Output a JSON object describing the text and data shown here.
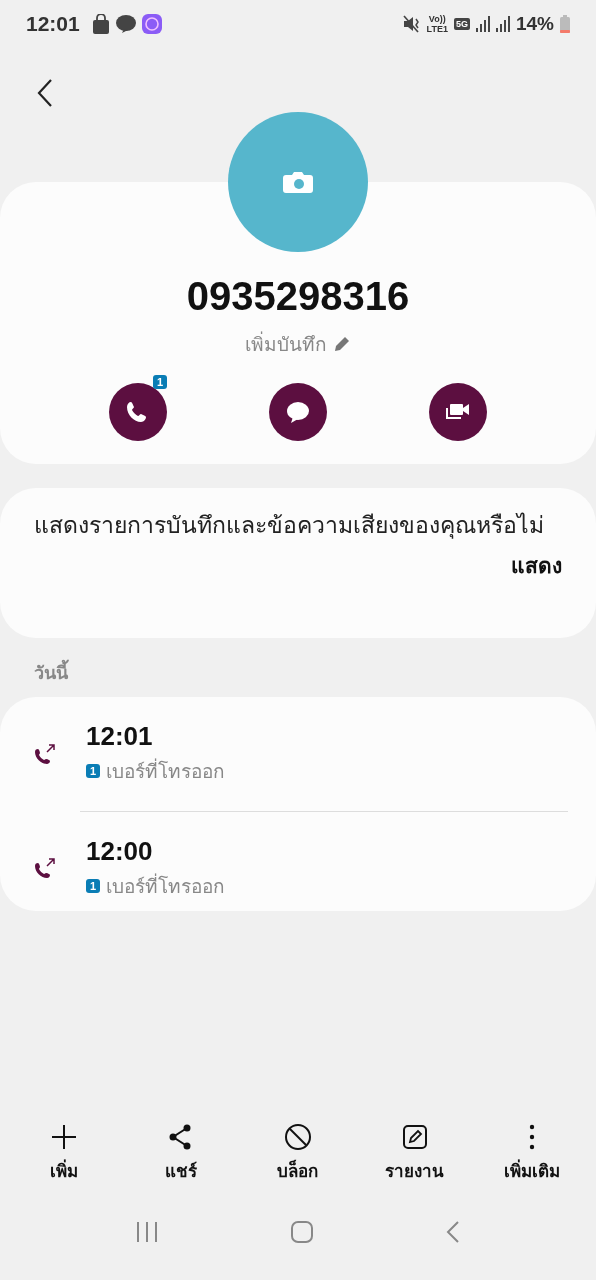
{
  "status_bar": {
    "time": "12:01",
    "volte": "Vo))",
    "lte": "LTE1",
    "network": "5G",
    "battery": "14%"
  },
  "contact": {
    "number": "0935298316",
    "note_link": "เพิ่มบันทึก"
  },
  "actions": [
    {
      "kind": "call",
      "badge": "1"
    },
    {
      "kind": "message"
    },
    {
      "kind": "video"
    }
  ],
  "prompt": {
    "text": "แสดงรายการบันทึกและข้อความเสียงของคุณหรือไม่",
    "button": "แสดง"
  },
  "log": {
    "section": "วันนี้",
    "calls": [
      {
        "time": "12:01",
        "sim": "1",
        "type": "เบอร์ที่โทรออก"
      },
      {
        "time": "12:00",
        "sim": "1",
        "type": "เบอร์ที่โทรออก"
      }
    ]
  },
  "toolbar": [
    {
      "kind": "add",
      "label": "เพิ่ม"
    },
    {
      "kind": "share",
      "label": "แชร์"
    },
    {
      "kind": "block",
      "label": "บล็อก"
    },
    {
      "kind": "report",
      "label": "รายงาน"
    },
    {
      "kind": "more",
      "label": "เพิ่มเติม"
    }
  ]
}
